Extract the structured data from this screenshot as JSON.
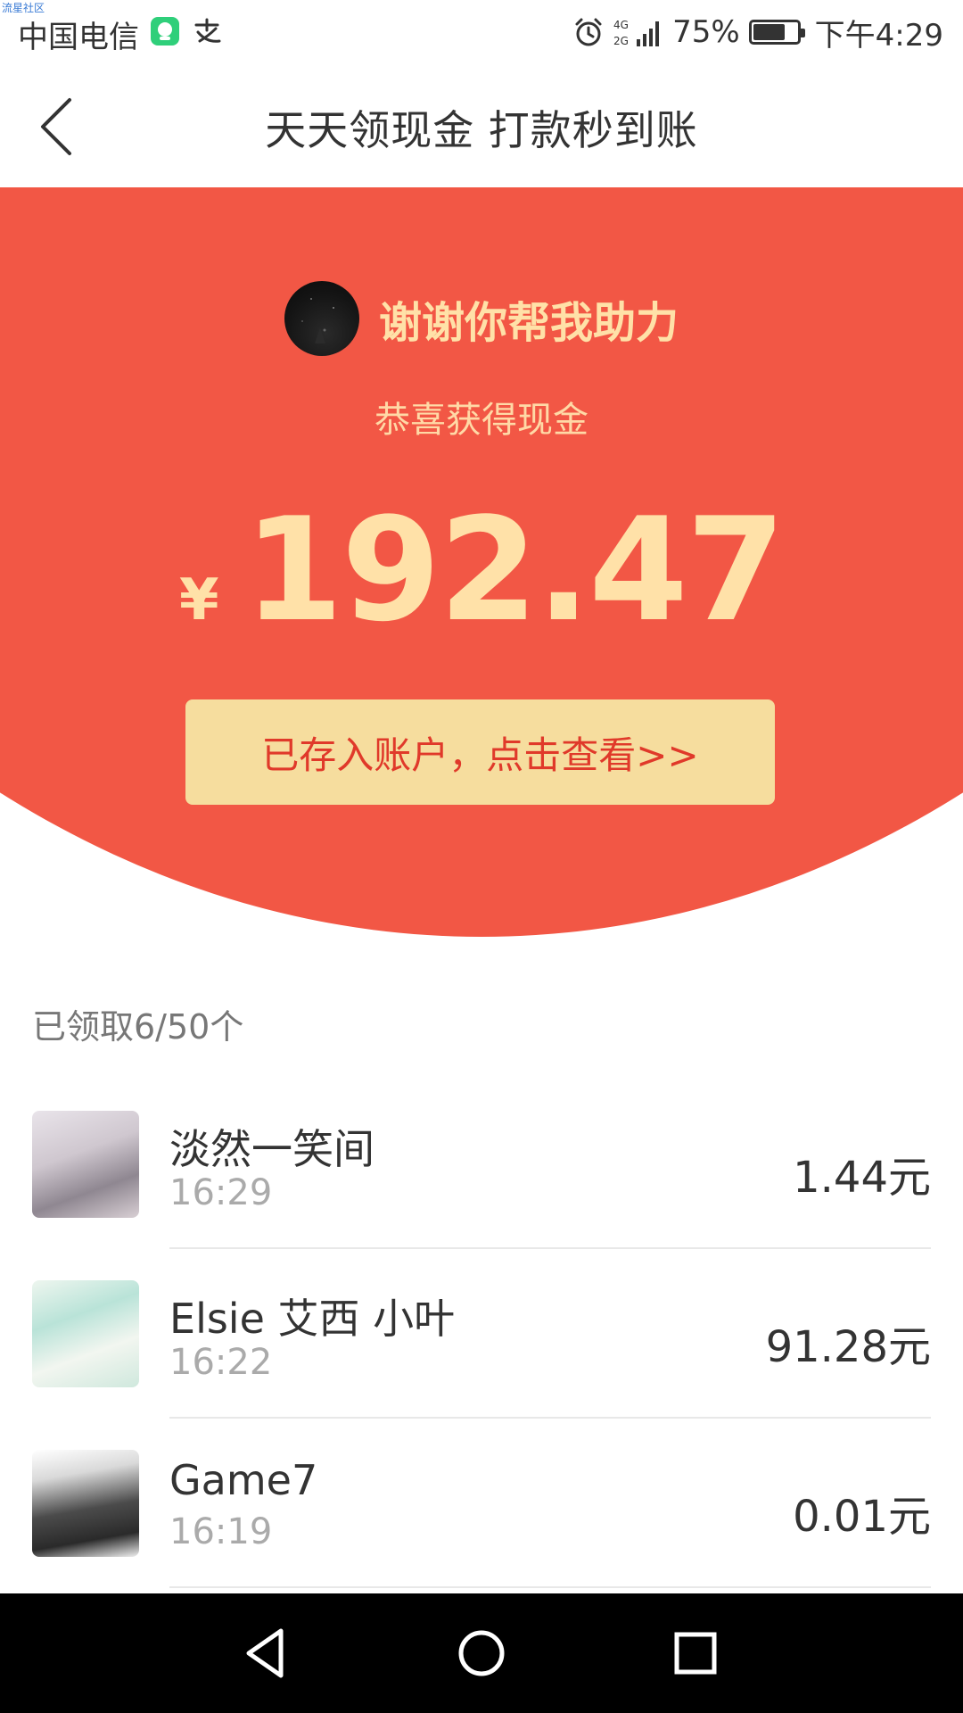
{
  "status_bar": {
    "watermark": "流星社区",
    "carrier": "中国电信",
    "network": "4G 2G",
    "battery": "75%",
    "battery_level": 0.75,
    "time": "下午4:29",
    "icons": [
      "app-notification-icon",
      "alipay-icon",
      "alarm-icon",
      "signal-icon",
      "battery-icon"
    ]
  },
  "navbar": {
    "title": "天天领现金 打款秒到账",
    "back_icon": "chevron-left-icon"
  },
  "hero": {
    "background_color": "#f25745",
    "greeting": "谢谢你帮我助力",
    "subtitle": "恭喜获得现金",
    "currency": "¥",
    "amount": "192.47",
    "cta_label": "已存入账户，点击查看>>"
  },
  "received": {
    "label": "已领取6/50个"
  },
  "claims": [
    {
      "name": "淡然一笑间",
      "time": "16:29",
      "amount": "1.44元"
    },
    {
      "name": "Elsie 艾西 小叶",
      "time": "16:22",
      "amount": "91.28元"
    },
    {
      "name": "Game7",
      "time": "16:19",
      "amount": "0.01元"
    }
  ],
  "system_nav": {
    "icons": [
      "back-triangle-icon",
      "home-circle-icon",
      "recents-square-icon"
    ]
  }
}
